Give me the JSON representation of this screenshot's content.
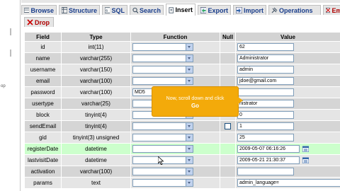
{
  "tabs": [
    {
      "label": "Browse",
      "icon": "browse-icon",
      "active": false
    },
    {
      "label": "Structure",
      "icon": "structure-icon",
      "active": false
    },
    {
      "label": "SQL",
      "icon": "sql-icon",
      "active": false
    },
    {
      "label": "Search",
      "icon": "search-icon",
      "active": false
    },
    {
      "label": "Insert",
      "icon": "insert-icon",
      "active": true
    },
    {
      "label": "Export",
      "icon": "export-icon",
      "active": false
    },
    {
      "label": "Import",
      "icon": "import-icon",
      "active": false
    },
    {
      "label": "Operations",
      "icon": "operations-icon",
      "active": false
    },
    {
      "label": "Empty",
      "icon": "empty-icon",
      "active": false
    },
    {
      "label": "Drop",
      "icon": "drop-icon",
      "active": false
    }
  ],
  "left_gutter_text": "op",
  "table": {
    "headers": {
      "field": "Field",
      "type": "Type",
      "function": "Function",
      "null": "Null",
      "value": "Value"
    },
    "rows": [
      {
        "field": "id",
        "type": "int(11)",
        "function": "",
        "null": false,
        "value": "62"
      },
      {
        "field": "name",
        "type": "varchar(255)",
        "function": "",
        "null": false,
        "value": "Administrator"
      },
      {
        "field": "username",
        "type": "varchar(150)",
        "function": "",
        "null": false,
        "value": "admin"
      },
      {
        "field": "email",
        "type": "varchar(100)",
        "function": "",
        "null": false,
        "value": "jdoe@gmail.com"
      },
      {
        "field": "password",
        "type": "varchar(100)",
        "function": "MD5",
        "null": false,
        "value": ""
      },
      {
        "field": "usertype",
        "type": "varchar(25)",
        "function": "",
        "null": false,
        "value": "nistrator"
      },
      {
        "field": "block",
        "type": "tinyint(4)",
        "function": "",
        "null": false,
        "value": "0"
      },
      {
        "field": "sendEmail",
        "type": "tinyint(4)",
        "function": "",
        "null": true,
        "value": "1"
      },
      {
        "field": "gid",
        "type": "tinyint(3) unsigned",
        "function": "",
        "null": false,
        "value": "25"
      },
      {
        "field": "registerDate",
        "type": "datetime",
        "function": "",
        "null": false,
        "value": "2009-05-07 06:16:26"
      },
      {
        "field": "lastvisitDate",
        "type": "datetime",
        "function": "",
        "null": false,
        "value": "2009-05-21 21:30:37"
      },
      {
        "field": "activation",
        "type": "varchar(100)",
        "function": "",
        "null": false,
        "value": ""
      },
      {
        "field": "params",
        "type": "text",
        "function": "",
        "null": false,
        "value": "admin_language="
      }
    ]
  },
  "tooltip": {
    "line1": "Now, scroll down and click",
    "line2": "Go"
  },
  "colors": {
    "accent": "#f3aa0a",
    "row_odd": "#e5e5e5",
    "row_even": "#d5d5d5",
    "row_highlight": "#ccffcc",
    "header": "#d3d3d3"
  }
}
